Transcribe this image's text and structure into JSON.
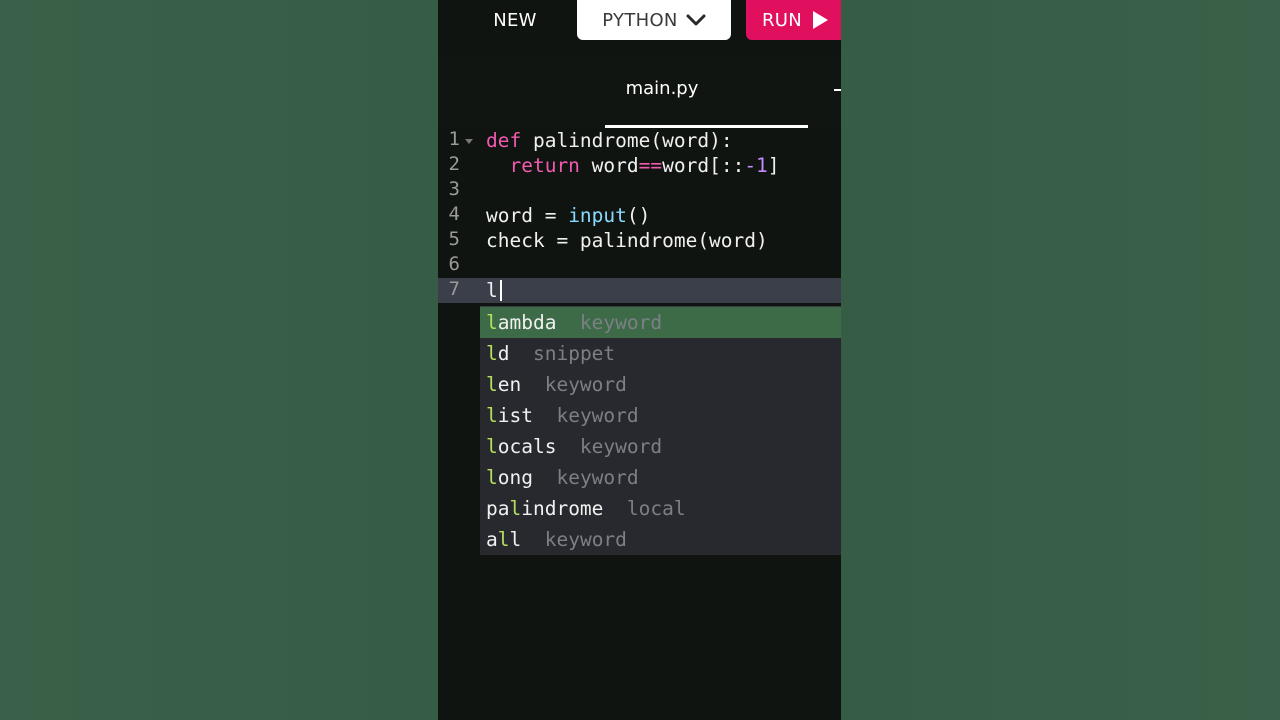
{
  "toolbar": {
    "new_label": "NEW",
    "language": "PYTHON",
    "run_label": "RUN",
    "run_color": "#e0105f"
  },
  "tabs": [
    {
      "label": "main.py",
      "active": true
    }
  ],
  "editor": {
    "line_numbers": [
      "1",
      "2",
      "3",
      "4",
      "5",
      "6",
      "7"
    ],
    "lines": [
      {
        "indent": "",
        "tokens": [
          {
            "t": "def",
            "c": "kw"
          },
          {
            "t": " palindrome(word):"
          }
        ]
      },
      {
        "indent": "  ",
        "tokens": [
          {
            "t": "return",
            "c": "kw"
          },
          {
            "t": " word"
          },
          {
            "t": "==",
            "c": "kw"
          },
          {
            "t": "word[::"
          },
          {
            "t": "-1",
            "c": "num"
          },
          {
            "t": "]"
          }
        ]
      },
      {
        "indent": "",
        "tokens": []
      },
      {
        "indent": "",
        "tokens": [
          {
            "t": "word = "
          },
          {
            "t": "input",
            "c": "fn"
          },
          {
            "t": "()"
          }
        ]
      },
      {
        "indent": "",
        "tokens": [
          {
            "t": "check = palindrome(word)"
          }
        ]
      },
      {
        "indent": "",
        "tokens": []
      },
      {
        "indent": "",
        "tokens": [
          {
            "t": "l"
          }
        ]
      }
    ],
    "active_line": 7
  },
  "autocomplete": {
    "items": [
      {
        "pre": "",
        "match": "l",
        "post": "ambda",
        "meta": "keyword",
        "selected": true
      },
      {
        "pre": "",
        "match": "l",
        "post": "d",
        "meta": "snippet"
      },
      {
        "pre": "",
        "match": "l",
        "post": "en",
        "meta": "keyword"
      },
      {
        "pre": "",
        "match": "l",
        "post": "ist",
        "meta": "keyword"
      },
      {
        "pre": "",
        "match": "l",
        "post": "ocals",
        "meta": "keyword"
      },
      {
        "pre": "",
        "match": "l",
        "post": "ong",
        "meta": "keyword"
      },
      {
        "pre": "pa",
        "match": "l",
        "post": "indrome",
        "meta": "local"
      },
      {
        "pre": "a",
        "match": "l",
        "post": "l",
        "meta": "keyword"
      }
    ]
  },
  "colors": {
    "background": "#355b45",
    "editor_bg": "#0f1410",
    "keyword": "#f25ab0",
    "builtin": "#8ad9ff",
    "number": "#c58cff",
    "match_highlight": "#b6df5e",
    "selected_item": "#3d6b48"
  },
  "icons": {
    "language_dropdown": "chevron-down-icon",
    "run": "play-icon"
  }
}
